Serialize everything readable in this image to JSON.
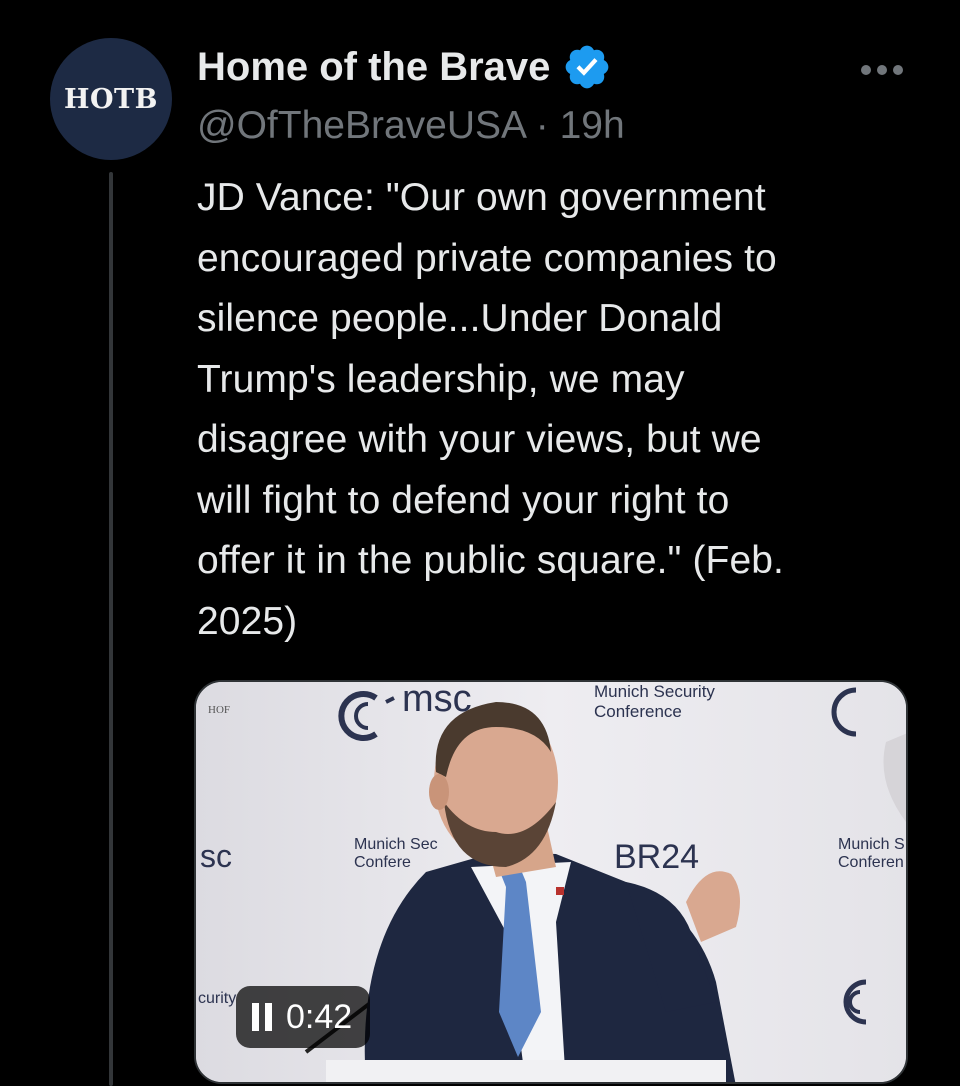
{
  "avatar": {
    "text": "HOTB"
  },
  "author": {
    "display_name": "Home of the Brave",
    "handle": "@OfTheBraveUSA",
    "separator": "·",
    "time_ago": "19h",
    "verified_color": "#1d9bf0"
  },
  "tweet": {
    "text": "JD Vance: \"Our own government\nencouraged private companies to\nsilence people...Under Donald\nTrump's leadership, we may\ndisagree with your views, but we\nwill fight to defend your right to\noffer it in the public square.\" (Feb.\n2025)"
  },
  "video": {
    "logo_msc": "msc",
    "hop_text": "HOF",
    "munich_security": "Munich Security",
    "conference": "Conference",
    "left_sc": "sc",
    "munich_sec_cut": "Munich Sec",
    "confer_cut": "Confere",
    "br24": "BR24",
    "right_munich": "Munich S",
    "right_conference": "Conferen",
    "curity": "curity",
    "time": "0:42"
  },
  "colors": {
    "background": "#000000",
    "text_primary": "#e7e9ea",
    "text_secondary": "#71767b",
    "accent": "#1d9bf0"
  }
}
